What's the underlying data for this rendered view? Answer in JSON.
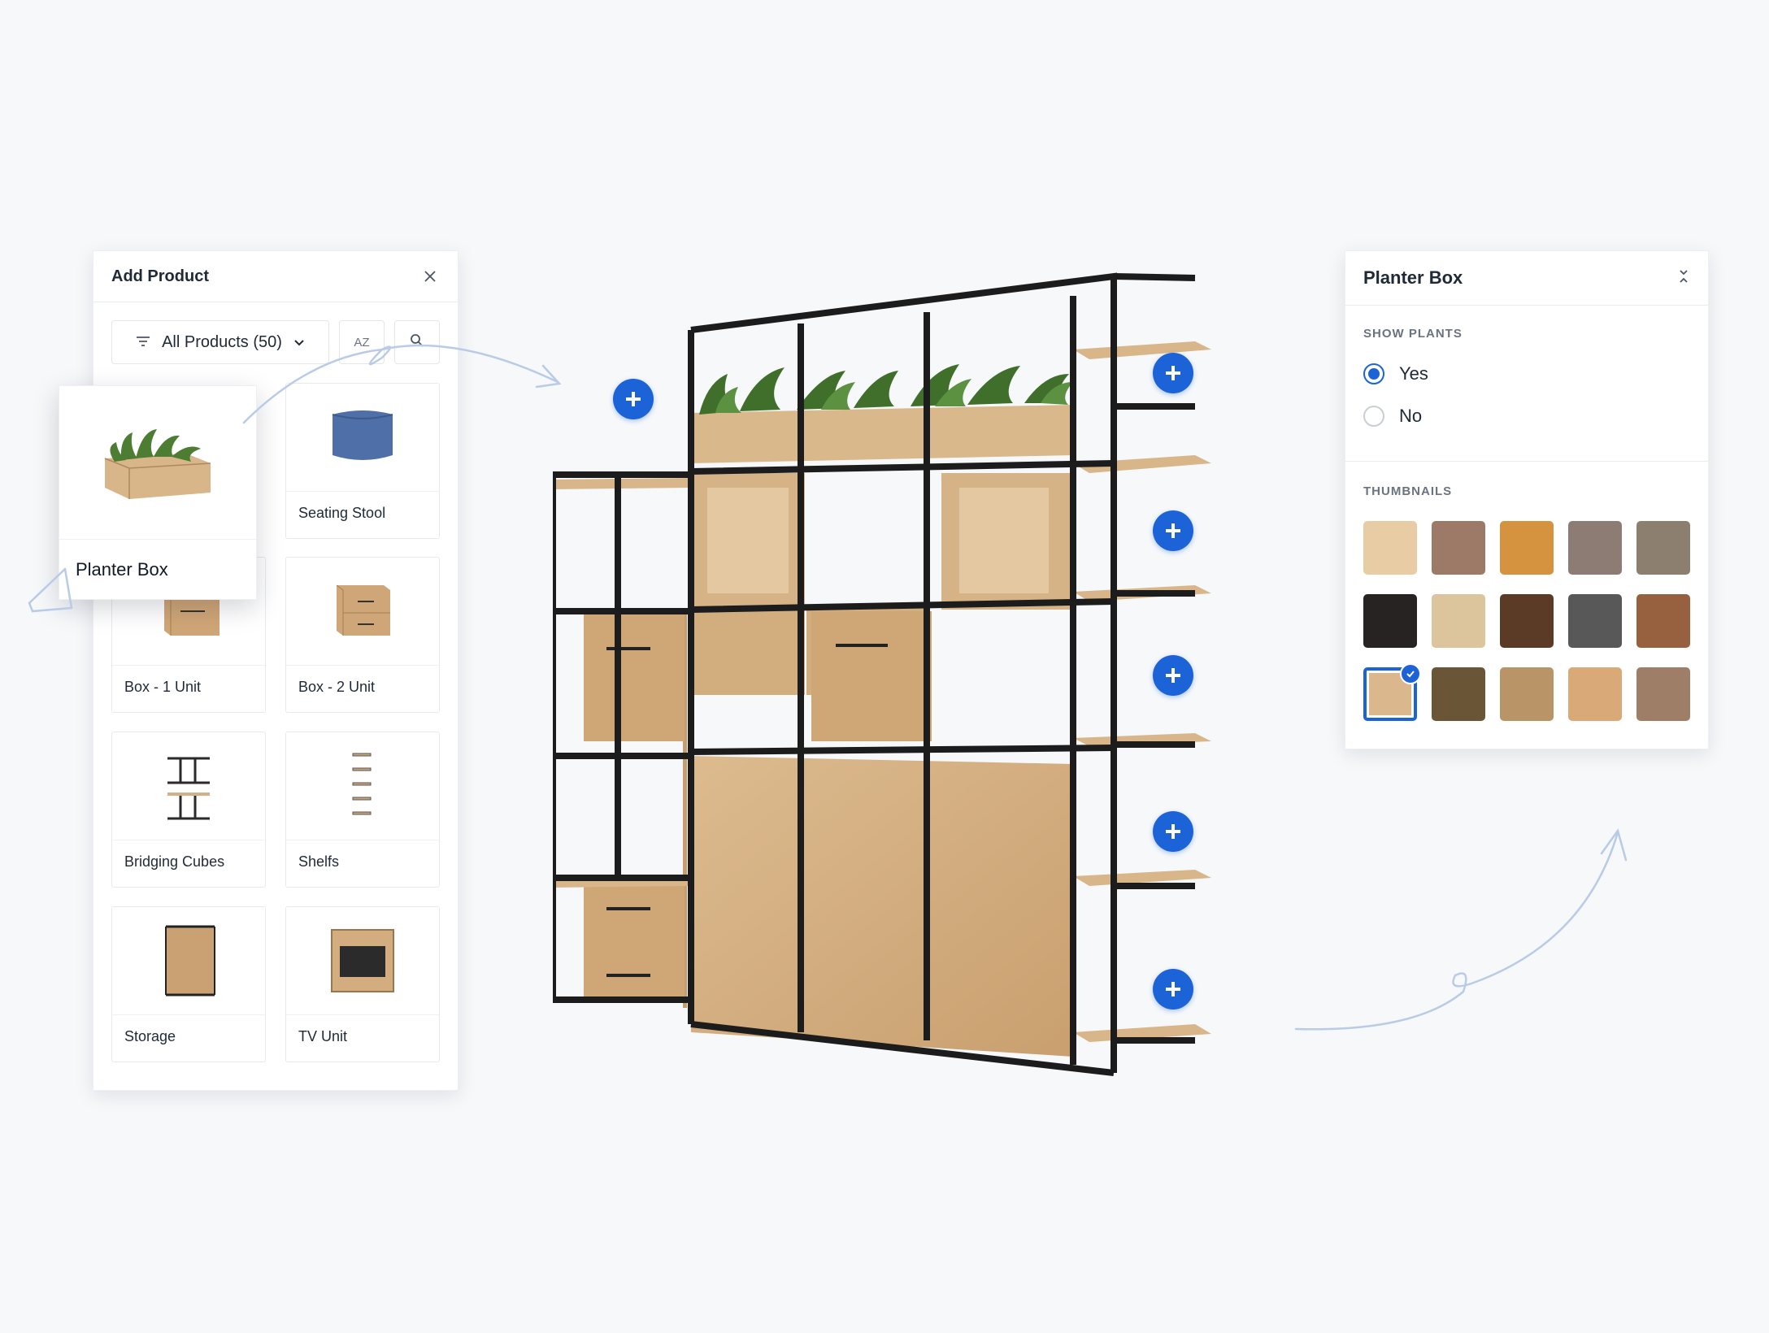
{
  "add_product_panel": {
    "title": "Add Product",
    "filter_label": "All Products (50)",
    "sort_label": "AZ",
    "products": [
      {
        "label": "Seating Stool",
        "icon": "seating-stool-thumbnail"
      },
      {
        "label": "Box - 1 Unit",
        "icon": "box-1-unit-thumbnail"
      },
      {
        "label": "Box - 2 Unit",
        "icon": "box-2-unit-thumbnail"
      },
      {
        "label": "Bridging Cubes",
        "icon": "bridging-cubes-thumbnail"
      },
      {
        "label": "Shelfs",
        "icon": "shelfs-thumbnail"
      },
      {
        "label": "Storage",
        "icon": "storage-thumbnail"
      },
      {
        "label": "TV Unit",
        "icon": "tv-unit-thumbnail"
      }
    ],
    "dragged_product": {
      "label": "Planter Box",
      "icon": "planter-box-thumbnail"
    }
  },
  "config_panel": {
    "title": "Planter Box",
    "show_plants": {
      "label": "SHOW PLANTS",
      "options": [
        "Yes",
        "No"
      ],
      "selected": "Yes"
    },
    "thumbnails": {
      "label": "THUMBNAILS",
      "selected_index": 10,
      "swatches": [
        "#e8cda4",
        "#9c7a67",
        "#d5923f",
        "#8c7c74",
        "#8d7f70",
        "#272322",
        "#dcc49c",
        "#5b3b25",
        "#585859",
        "#97603f",
        "#dbb78e",
        "#6a5637",
        "#b89467",
        "#d9aa78",
        "#9e7e66"
      ]
    }
  },
  "scene": {
    "add_point_count": 6,
    "accent_color": "#1d63d8",
    "wood_color": "#d8b68a",
    "frame_color": "#1c1c1c"
  }
}
